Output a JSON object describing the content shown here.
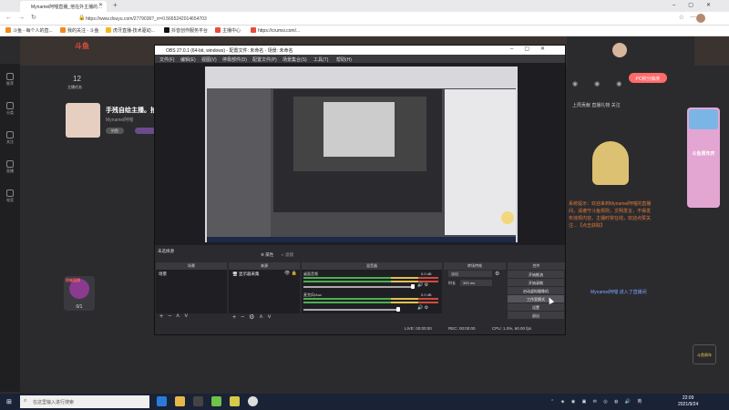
{
  "browser": {
    "tab_title": "Mynamei阿喵直播_他在外主播的…",
    "url": "https://www.douyu.com/2779036?_rr=0.5665242014654703",
    "bookmarks": [
      "斗鱼 - 每个人的直...",
      "我的关注 - 斗鱼",
      "虎牙直播-技术驱动...",
      "抖音创作服务平台",
      "主播中心",
      "https://crumsi.com/..."
    ],
    "icons": {
      "tab": "douyu-icon",
      "back": "back-icon",
      "forward": "forward-icon",
      "refresh": "refresh-icon",
      "home": "home-icon",
      "lock": "lock-icon"
    }
  },
  "page": {
    "logo": "斗鱼",
    "stat_num": "12",
    "stat_lbl": "主播任务",
    "streamer_title": "手残自绘主播。拍",
    "streamer_sub": "Mynamei阿喵",
    "pill": "钓鱼",
    "rail": [
      "推荐",
      "分类",
      "关注",
      "直播",
      "电竞",
      "游戏",
      "娱乐"
    ],
    "left_card_tag": "阿喵直播",
    "left_card_label": "0/1",
    "right_btn": "PC积分抽奖",
    "right_tabs": "上周贡献  直播礼物  关注",
    "chat": "系统提示：欢迎来到Mynamei阿喵的直播间，请遵守斗鱼规则，文明发言，不得发布违规内容。主播时常在线，欢迎点赞关注…【点击获取】",
    "chat_user": "Mynamei阿喵  进入了直播间",
    "chat_link": "【点击获取】",
    "side_banner": "斗鱼周年庆",
    "mini_badge": "斗鱼周年"
  },
  "obs": {
    "title": "OBS 27.0.1 (64-bit, windows) - 配置文件: 未命名 - 场景: 未命名",
    "menu": [
      "文件(F)",
      "编辑(E)",
      "视图(V)",
      "停靠部件(D)",
      "配置文件(P)",
      "场景集合(S)",
      "工具(T)",
      "帮助(H)"
    ],
    "scene_label": "未选择源",
    "scene_switch": [
      "属性",
      "滤镜"
    ],
    "docks": [
      "场景",
      "来源",
      "混音器",
      "转场特效",
      "控件"
    ],
    "scene_item": "场景",
    "source_item": "显示器采集",
    "mixer": [
      {
        "name": "桌面音频",
        "level": "0.0 dB"
      },
      {
        "name": "麦克风/Aux",
        "level": "0.0 dB"
      }
    ],
    "transition": "淡出",
    "duration_label": "时长",
    "duration": "300 ms",
    "controls": [
      "开始推流",
      "开始录制",
      "启动虚拟摄像机",
      "工作室模式",
      "设置",
      "退出"
    ],
    "status": {
      "live": "LIVE: 00:00:00",
      "rec": "REC: 00:00:00",
      "cpu": "CPU: 1.0%, 60.00 fps"
    }
  },
  "taskbar": {
    "search": "在这里输入进行搜索",
    "time": "22:09",
    "date": "2021/9/24"
  }
}
